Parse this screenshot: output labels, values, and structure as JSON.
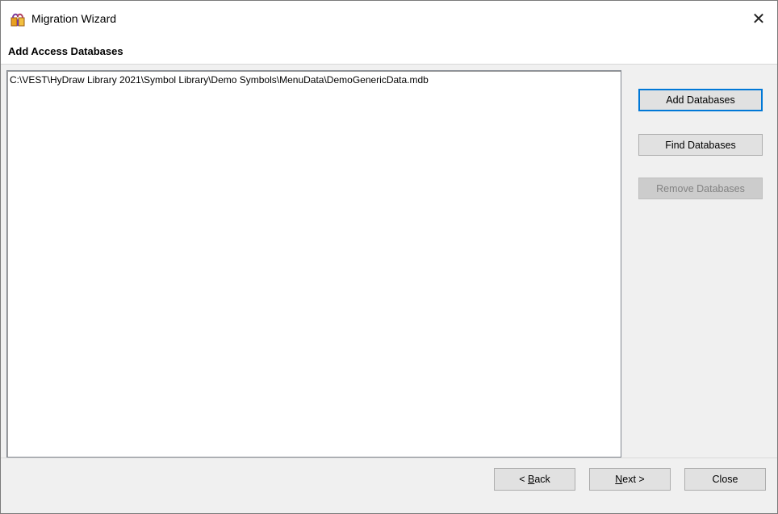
{
  "window": {
    "title": "Migration Wizard",
    "close_glyph": "✕"
  },
  "page": {
    "heading": "Add Access Databases"
  },
  "database_list": {
    "items": [
      "C:\\VEST\\HyDraw Library 2021\\Symbol Library\\Demo Symbols\\MenuData\\DemoGenericData.mdb"
    ]
  },
  "side_buttons": {
    "add": "Add Databases",
    "find": "Find Databases",
    "remove": "Remove Databases"
  },
  "footer": {
    "back_prefix": "< ",
    "back_mnemonic": "B",
    "back_rest": "ack",
    "next_mnemonic": "N",
    "next_rest": "ext >",
    "close": "Close"
  },
  "colors": {
    "default_button_border": "#0078d7",
    "disabled_text": "#838383",
    "dialog_background": "#f0f0f0"
  },
  "icons": {
    "app": "migration-wizard-icon",
    "close": "close-icon"
  }
}
